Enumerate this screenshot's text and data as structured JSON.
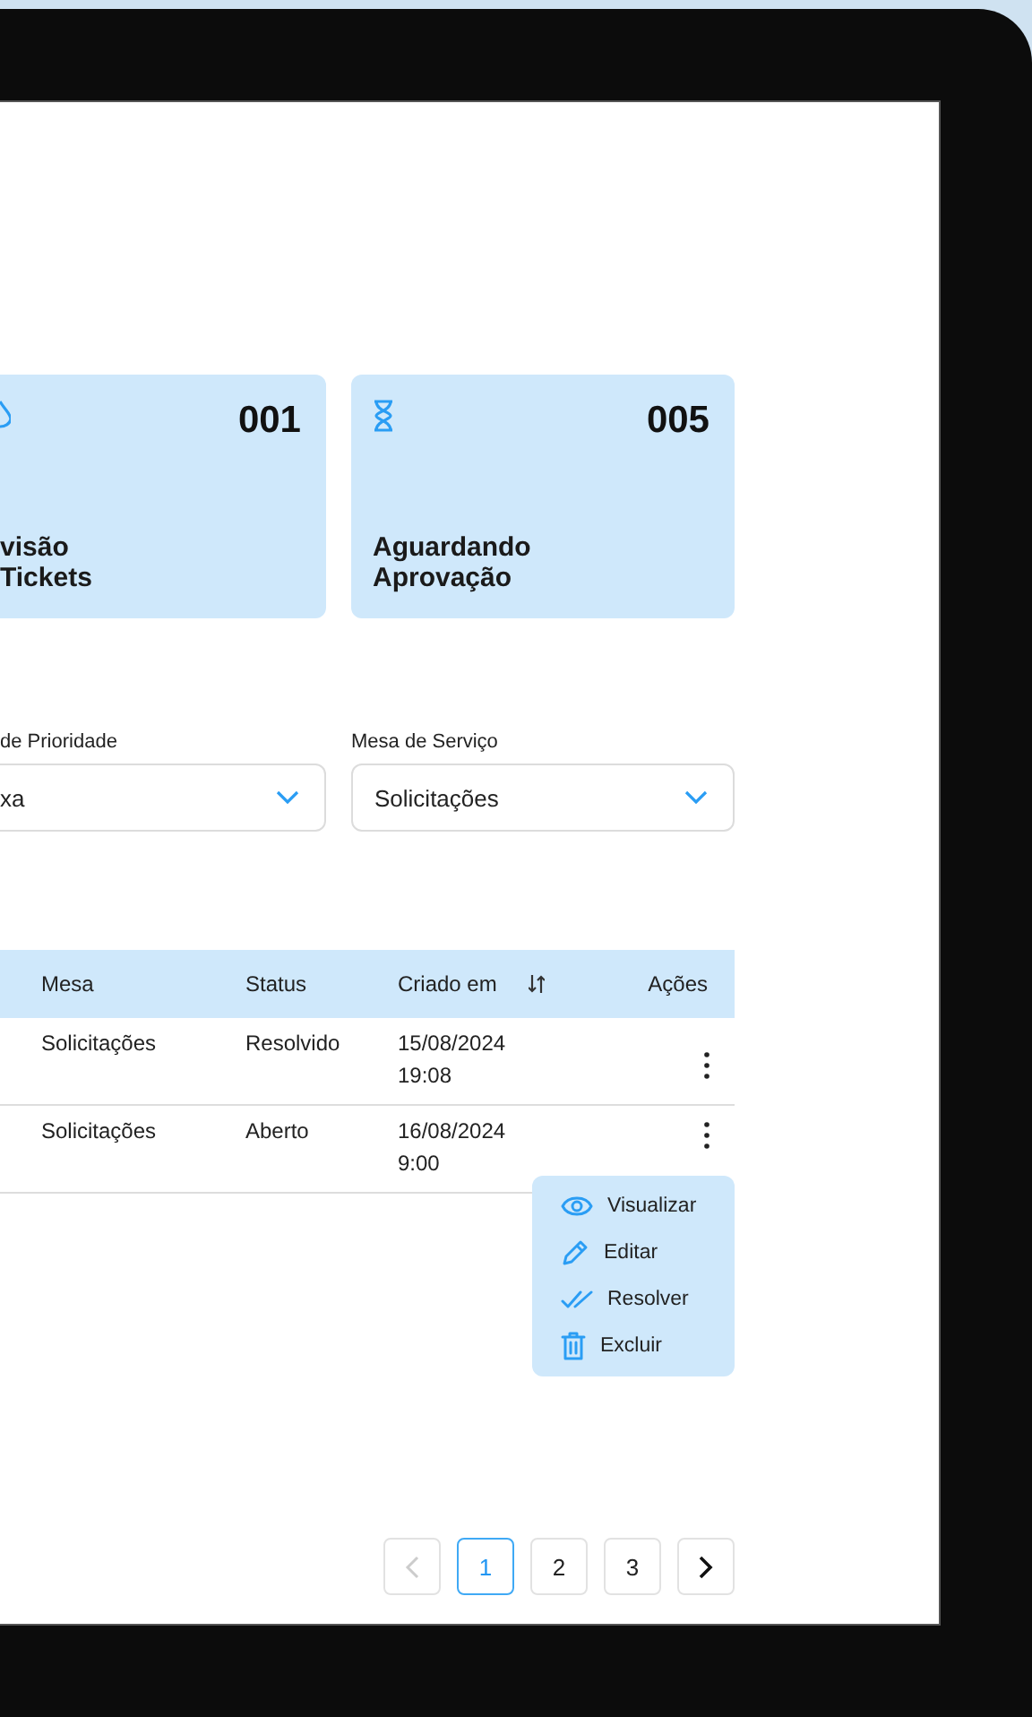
{
  "cards": [
    {
      "kind": "drop",
      "count": "001",
      "title_lines": [
        "visão",
        "Tickets"
      ]
    },
    {
      "kind": "hourglass",
      "count": "005",
      "title_lines": [
        "Aguardando",
        "Aprovação"
      ]
    }
  ],
  "filters": [
    {
      "label": "de Prioridade",
      "value": "xa"
    },
    {
      "label": "Mesa de Serviço",
      "value": "Solicitações"
    }
  ],
  "table": {
    "columns": [
      {
        "label": "Mesa",
        "sortable": false
      },
      {
        "label": "Status",
        "sortable": false
      },
      {
        "label": "Criado em",
        "sortable": true
      },
      {
        "label": "Ações",
        "sortable": false
      }
    ],
    "rows": [
      {
        "mesa": "Solicitações",
        "status": "Resolvido",
        "date": "15/08/2024",
        "time": "19:08"
      },
      {
        "mesa": "Solicitações",
        "status": "Aberto",
        "date": "16/08/2024",
        "time": "9:00"
      }
    ]
  },
  "row_menu": [
    {
      "kind": "view",
      "label": "Visualizar"
    },
    {
      "kind": "edit",
      "label": "Editar"
    },
    {
      "kind": "resolve",
      "label": "Resolver"
    },
    {
      "kind": "delete",
      "label": "Excluir"
    }
  ],
  "pagination": {
    "prev_disabled": true,
    "next_disabled": false,
    "pages": [
      {
        "label": "1",
        "selected": true
      },
      {
        "label": "2",
        "selected": false
      },
      {
        "label": "3",
        "selected": false
      }
    ]
  }
}
